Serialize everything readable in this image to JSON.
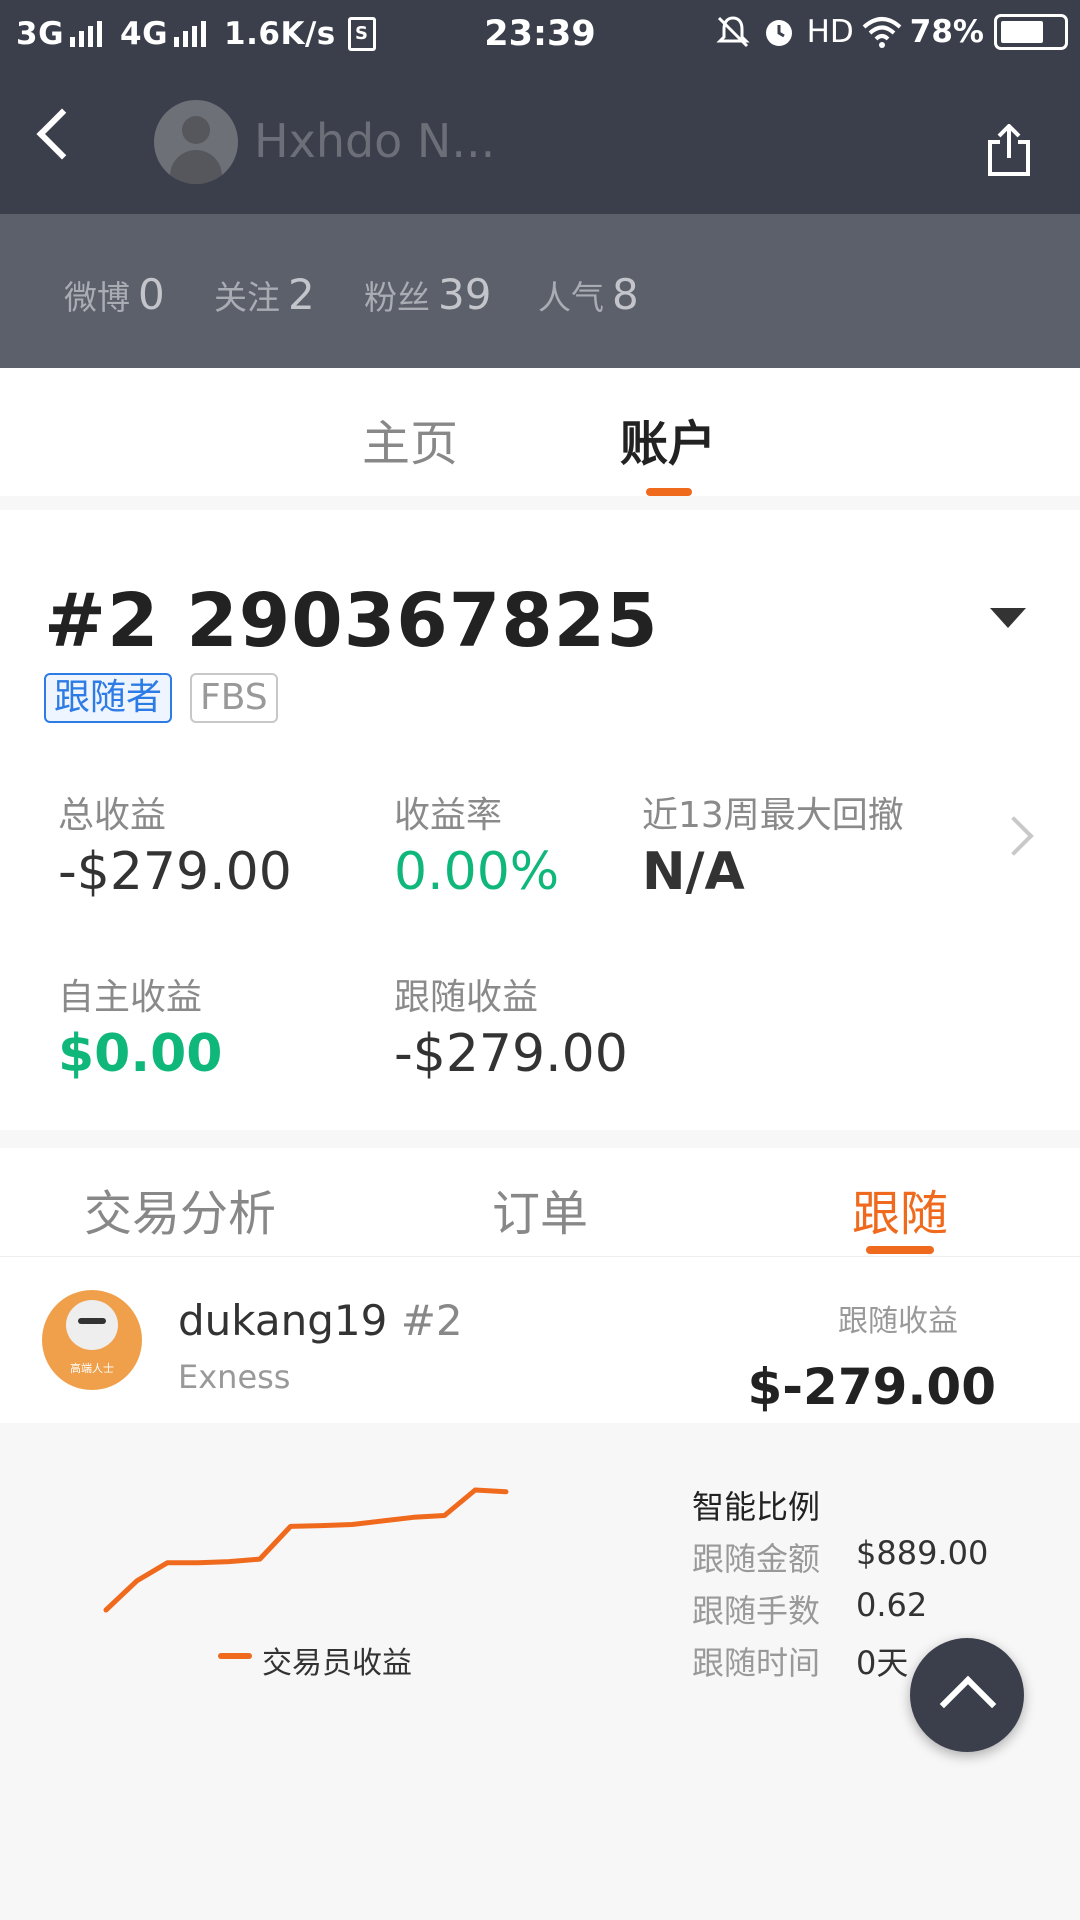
{
  "status_bar": {
    "net1": "3G",
    "net2": "4G",
    "speed": "1.6K/s",
    "sim_icon": "S",
    "time": "23:39",
    "hd": "HD",
    "battery": "78%",
    "battery_level": 0.78
  },
  "header": {
    "username": "Hxhdo N...",
    "icons": {
      "back": "chevron-left-icon",
      "share": "share-icon"
    }
  },
  "stats": [
    {
      "label": "微博",
      "value": "0"
    },
    {
      "label": "关注",
      "value": "2"
    },
    {
      "label": "粉丝",
      "value": "39"
    },
    {
      "label": "人气",
      "value": "8"
    }
  ],
  "main_tabs": [
    {
      "label": "主页",
      "active": false
    },
    {
      "label": "账户",
      "active": true
    }
  ],
  "account": {
    "title": "#2 290367825",
    "badges": [
      "跟随者",
      "FBS"
    ],
    "metrics": [
      {
        "label": "总收益",
        "value": "-$279.00"
      },
      {
        "label": "收益率",
        "value": "0.00%"
      },
      {
        "label": "近13周最大回撤",
        "value": "N/A"
      },
      {
        "label": "自主收益",
        "value": "$0.00"
      },
      {
        "label": "跟随收益",
        "value": "-$279.00"
      }
    ]
  },
  "sub_tabs": [
    {
      "label": "交易分析",
      "active": false
    },
    {
      "label": "订单",
      "active": false
    },
    {
      "label": "跟随",
      "active": true
    }
  ],
  "follow": {
    "name": "dukang19",
    "suffix": "#2",
    "broker": "Exness",
    "avatar_text": "高端人士",
    "profit_label": "跟随收益",
    "profit_value": "$-279.00"
  },
  "chart_data": {
    "type": "line",
    "series": [
      {
        "name": "交易员收益",
        "values": [
          0,
          8,
          13,
          13,
          13.3,
          14,
          23,
          23.2,
          23.5,
          24.5,
          25.5,
          26,
          33,
          32.5
        ]
      }
    ],
    "colors": {
      "line": "#f06a1d"
    }
  },
  "ratio": {
    "title": "智能比例",
    "rows": [
      {
        "label": "跟随金额",
        "value": "$889.00"
      },
      {
        "label": "跟随手数",
        "value": "0.62"
      },
      {
        "label": "跟随时间",
        "value": "0天"
      }
    ]
  },
  "colors": {
    "accent": "#f06a1d",
    "positive": "#10b77a",
    "header_bg": "#3b3f4b",
    "badge_blue": "#2d7be5"
  }
}
